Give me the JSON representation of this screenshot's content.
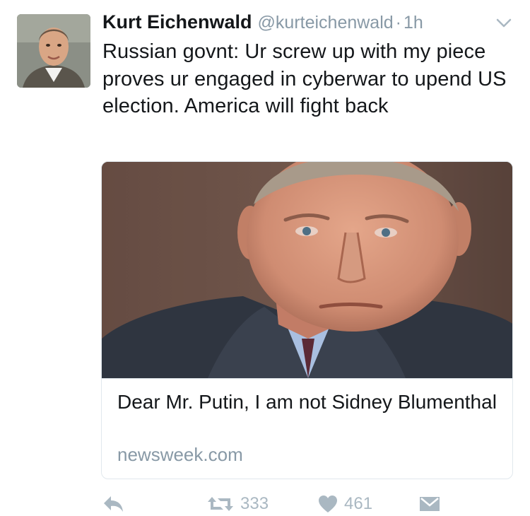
{
  "tweet": {
    "author_name": "Kurt Eichenwald",
    "handle": "@kurteichenwald",
    "separator": "·",
    "time": "1h",
    "text": "Russian govnt: Ur screw up with my piece proves ur engaged in cyberwar to upend US election. America will fight back",
    "avatar_icon": "author-avatar",
    "menu_icon": "chevron-down-icon"
  },
  "card": {
    "title": "Dear Mr. Putin, I am not Sidney Blumenthal",
    "domain": "newsweek.com",
    "image_icon": "article-photo"
  },
  "actions": {
    "reply_icon": "reply-icon",
    "retweet_icon": "retweet-icon",
    "retweet_count": "333",
    "like_icon": "heart-icon",
    "like_count": "461",
    "dm_icon": "envelope-icon"
  },
  "colors": {
    "text": "#14171a",
    "muted": "#8899a6",
    "action": "#aab8c2",
    "border": "#e1e8ed"
  }
}
